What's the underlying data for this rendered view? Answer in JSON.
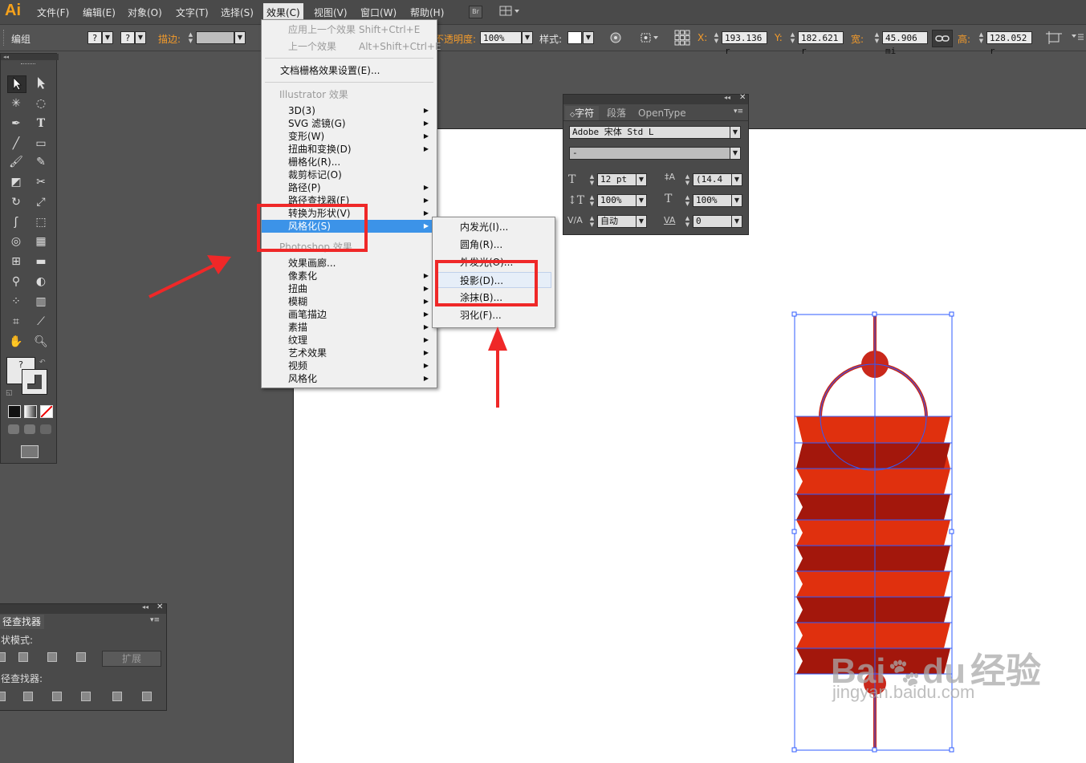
{
  "app": {
    "logo": "Ai"
  },
  "menubar": {
    "items": [
      {
        "label": "文件(F)"
      },
      {
        "label": "编辑(E)"
      },
      {
        "label": "对象(O)"
      },
      {
        "label": "文字(T)"
      },
      {
        "label": "选择(S)"
      },
      {
        "label": "效果(C)"
      },
      {
        "label": "视图(V)"
      },
      {
        "label": "窗口(W)"
      },
      {
        "label": "帮助(H)"
      }
    ],
    "br_label": "Br"
  },
  "controlbar": {
    "group_label": "编组",
    "stroke_label": "描边:",
    "opacity_label": "不透明度:",
    "opacity_value": "100%",
    "style_label": "样式:",
    "x_label": "X:",
    "x_value": "193.136 r",
    "y_label": "Y:",
    "y_value": "182.621 r",
    "w_label": "宽:",
    "w_value": "45.906 mi",
    "h_label": "高:",
    "h_value": "128.052 r",
    "question": "?"
  },
  "effect_menu": {
    "apply_last": "应用上一个效果",
    "apply_last_shortcut": "Shift+Ctrl+E",
    "last": "上一个效果",
    "last_shortcut": "Alt+Shift+Ctrl+E",
    "raster_settings": "文档栅格效果设置(E)...",
    "illustrator_section": "Illustrator 效果",
    "illustrator_items": [
      {
        "label": "3D(3)"
      },
      {
        "label": "SVG 滤镜(G)"
      },
      {
        "label": "变形(W)"
      },
      {
        "label": "扭曲和变换(D)"
      },
      {
        "label": "栅格化(R)..."
      },
      {
        "label": "裁剪标记(O)"
      },
      {
        "label": "路径(P)"
      },
      {
        "label": "路径查找器(F)"
      },
      {
        "label": "转换为形状(V)"
      },
      {
        "label": "风格化(S)"
      }
    ],
    "photoshop_section": "Photoshop 效果",
    "photoshop_items": [
      {
        "label": "效果画廊..."
      },
      {
        "label": "像素化"
      },
      {
        "label": "扭曲"
      },
      {
        "label": "模糊"
      },
      {
        "label": "画笔描边"
      },
      {
        "label": "素描"
      },
      {
        "label": "纹理"
      },
      {
        "label": "艺术效果"
      },
      {
        "label": "视频"
      },
      {
        "label": "风格化"
      }
    ]
  },
  "stylize_submenu": {
    "items": [
      {
        "label": "内发光(I)..."
      },
      {
        "label": "圆角(R)..."
      },
      {
        "label": "外发光(O)..."
      },
      {
        "label": "投影(D)..."
      },
      {
        "label": "涂抹(B)..."
      },
      {
        "label": "羽化(F)..."
      }
    ]
  },
  "character_panel": {
    "tabs": [
      {
        "label": "字符"
      },
      {
        "label": "段落"
      },
      {
        "label": "OpenType"
      }
    ],
    "font_family": "Adobe 宋体 Std L",
    "font_style": "-",
    "font_size": "12 pt",
    "leading": "(14.4",
    "vertical_scale": "100%",
    "horizontal_scale": "100%",
    "kerning": "自动",
    "tracking": "0"
  },
  "pathfinder_panel": {
    "title": "径查找器",
    "shape_modes_label": "状模式:",
    "expand_label": "扩展",
    "pathfinders_label": "径查找器:"
  },
  "watermark": {
    "brand": "Bai",
    "brand_suffix": "du",
    "cn": "经验",
    "url": "jingyan.baidu.com"
  },
  "colors": {
    "accent_orange": "#f39b2b",
    "highlight_blue": "#3c93e8",
    "annotation_red": "#ef2828",
    "lantern_light": "#e0300e",
    "lantern_dark": "#a3170c",
    "selection_blue": "#2f5bff"
  }
}
